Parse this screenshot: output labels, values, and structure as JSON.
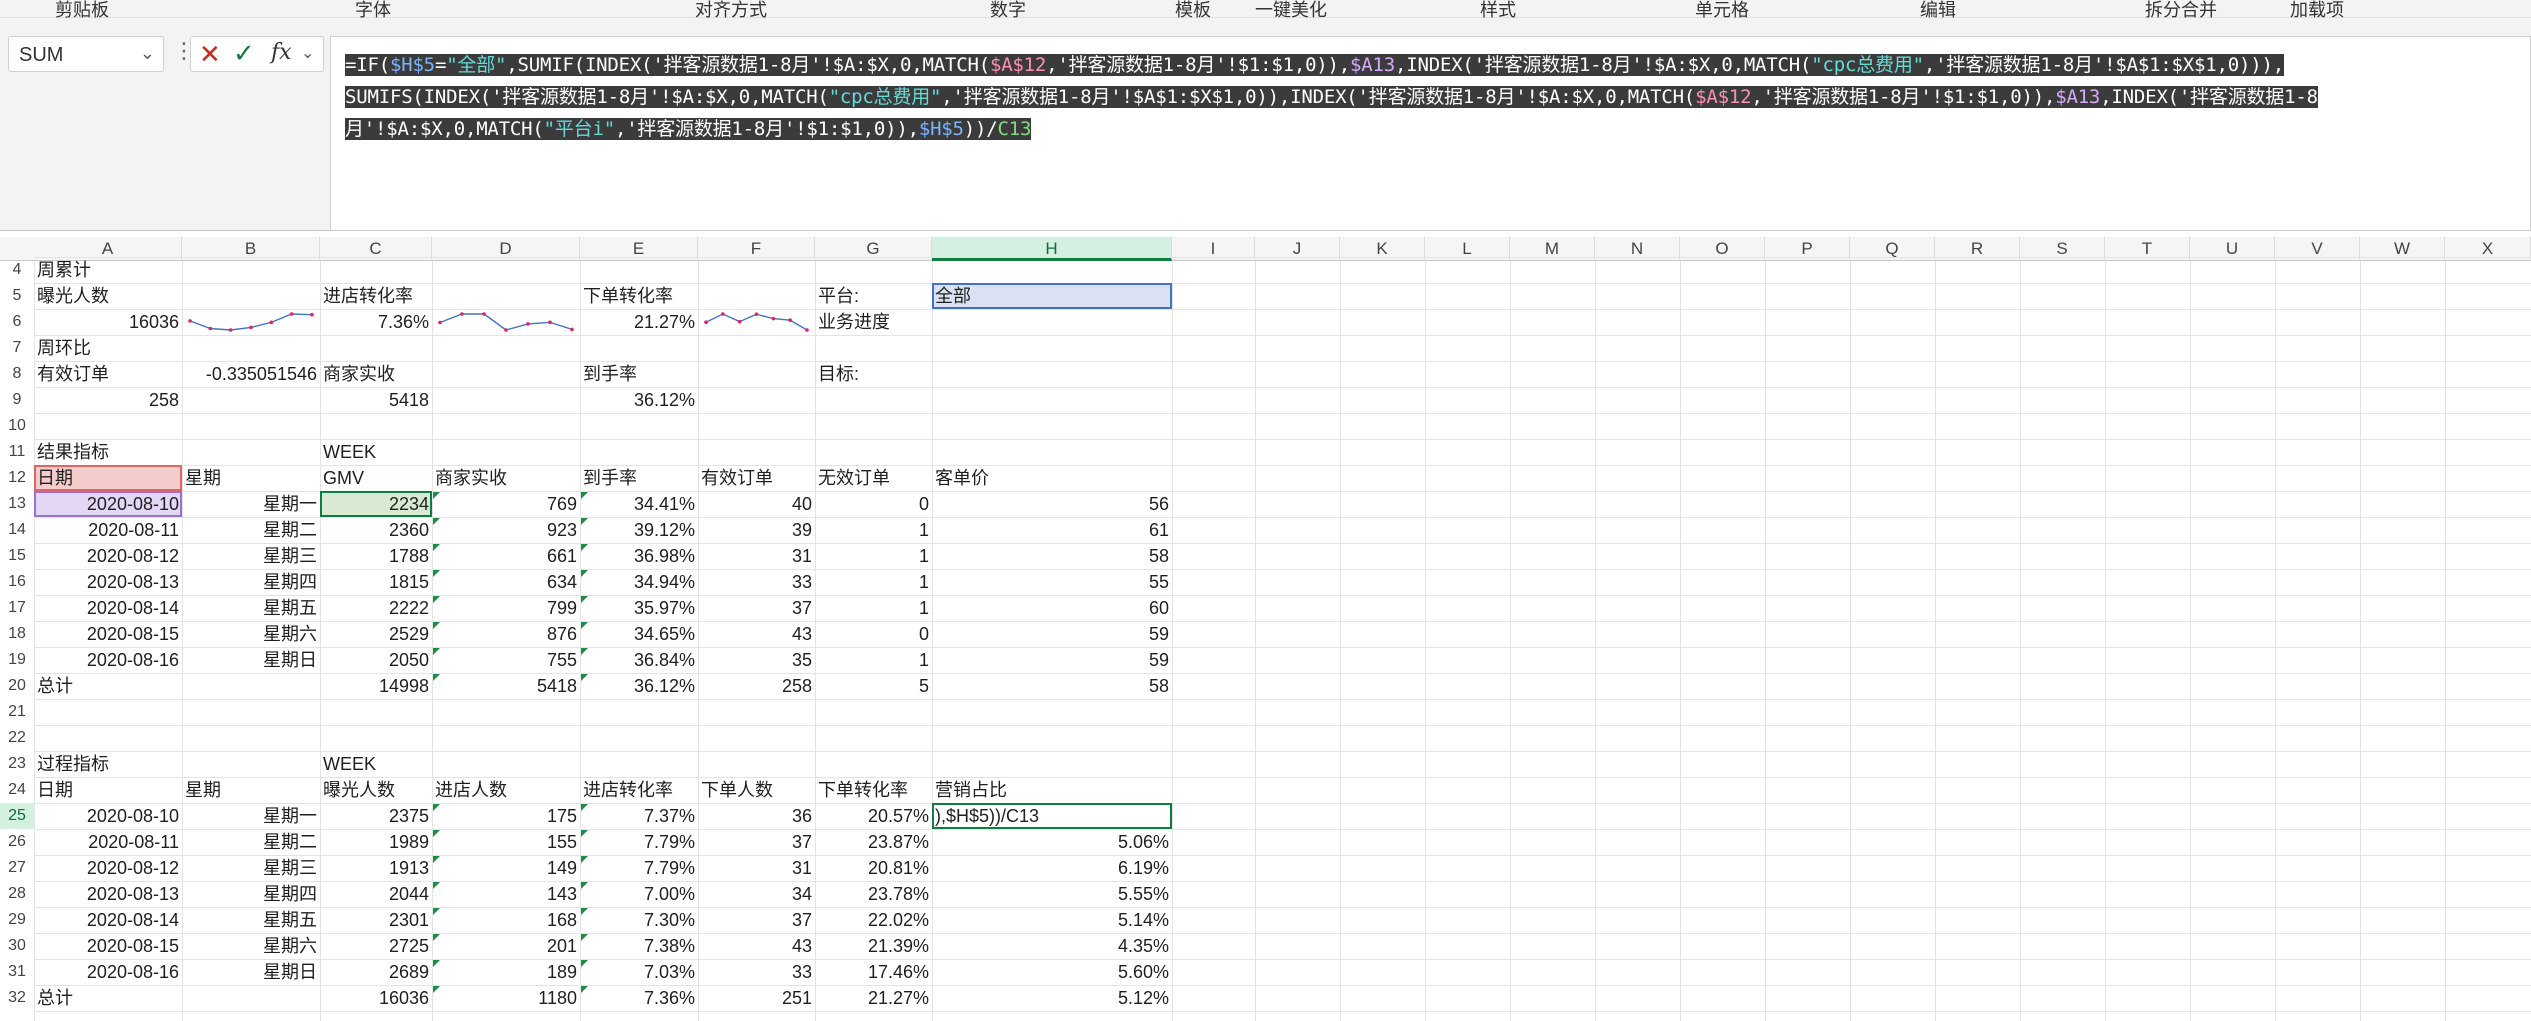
{
  "ribbon": {
    "groups": [
      "剪贴板",
      "字体",
      "对齐方式",
      "数字",
      "模板",
      "一键美化",
      "样式",
      "单元格",
      "编辑",
      "拆分合并",
      "加载项"
    ]
  },
  "formula_bar": {
    "name_box": "SUM",
    "fx_label": "fx",
    "formula_lines": [
      "=IF($H$5=\"全部\",SUMIF(INDEX('拌客源数据1-8月'!$A:$X,0,MATCH($A$12,'拌客源数据1-8月'!$1:$1,0)),$A13,INDEX('拌客源数据1-8月'!$A:$X,0,MATCH(\"cpc总费用\",'拌客源数据1-8月'!$A$1:$X$1,0))),",
      "SUMIFS(INDEX('拌客源数据1-8月'!$A:$X,0,MATCH(\"cpc总费用\",'拌客源数据1-8月'!$A$1:$X$1,0)),INDEX('拌客源数据1-8月'!$A:$X,0,MATCH($A$12,'拌客源数据1-8月'!$1:$1,0)),$A13,INDEX('拌客源数据1-8",
      "月'!$A:$X,0,MATCH(\"平台i\",'拌客源数据1-8月'!$1:$1,0)),$H$5))/C13"
    ]
  },
  "columns": [
    "A",
    "B",
    "C",
    "D",
    "E",
    "F",
    "G",
    "H",
    "I",
    "J",
    "K",
    "L",
    "M",
    "N",
    "O",
    "P",
    "Q",
    "R",
    "S",
    "T",
    "U",
    "V",
    "W",
    "X"
  ],
  "rows": [
    "4",
    "5",
    "6",
    "7",
    "8",
    "9",
    "10",
    "11",
    "12",
    "13",
    "14",
    "15",
    "16",
    "17",
    "18",
    "19",
    "20",
    "21",
    "22",
    "23",
    "24",
    "25",
    "26",
    "27",
    "28",
    "29",
    "30",
    "31",
    "32"
  ],
  "summary": {
    "a4": "周累计",
    "a5": "曝光人数",
    "c5": "进店转化率",
    "e5": "下单转化率",
    "g5": "平台:",
    "h5": "全部",
    "a6": "16036",
    "c6": "7.36%",
    "e6": "21.27%",
    "g6": "业务进度",
    "a7": "周环比",
    "a8": "有效订单",
    "b8": "-0.335051546",
    "c8": "商家实收",
    "e8": "到手率",
    "g8": "目标:",
    "a9": "258",
    "c9": "5418",
    "e9": "36.12%"
  },
  "results": {
    "section": "结果指标",
    "week_label": "WEEK",
    "headers": [
      "日期",
      "星期",
      "GMV",
      "商家实收",
      "到手率",
      "有效订单",
      "无效订单",
      "客单价"
    ],
    "rows": [
      [
        "2020-08-10",
        "星期一",
        "2234",
        "769",
        "34.41%",
        "40",
        "0",
        "56"
      ],
      [
        "2020-08-11",
        "星期二",
        "2360",
        "923",
        "39.12%",
        "39",
        "1",
        "61"
      ],
      [
        "2020-08-12",
        "星期三",
        "1788",
        "661",
        "36.98%",
        "31",
        "1",
        "58"
      ],
      [
        "2020-08-13",
        "星期四",
        "1815",
        "634",
        "34.94%",
        "33",
        "1",
        "55"
      ],
      [
        "2020-08-14",
        "星期五",
        "2222",
        "799",
        "35.97%",
        "37",
        "1",
        "60"
      ],
      [
        "2020-08-15",
        "星期六",
        "2529",
        "876",
        "34.65%",
        "43",
        "0",
        "59"
      ],
      [
        "2020-08-16",
        "星期日",
        "2050",
        "755",
        "36.84%",
        "35",
        "1",
        "59"
      ]
    ],
    "total": [
      "总计",
      "",
      "14998",
      "5418",
      "36.12%",
      "258",
      "5",
      "58"
    ]
  },
  "process": {
    "section": "过程指标",
    "week_label": "WEEK",
    "headers": [
      "日期",
      "星期",
      "曝光人数",
      "进店人数",
      "进店转化率",
      "下单人数",
      "下单转化率",
      "营销占比"
    ],
    "rows": [
      [
        "2020-08-10",
        "星期一",
        "2375",
        "175",
        "7.37%",
        "36",
        "20.57%",
        "),$H$5))/C13"
      ],
      [
        "2020-08-11",
        "星期二",
        "1989",
        "155",
        "7.79%",
        "37",
        "23.87%",
        "5.06%"
      ],
      [
        "2020-08-12",
        "星期三",
        "1913",
        "149",
        "7.79%",
        "31",
        "20.81%",
        "6.19%"
      ],
      [
        "2020-08-13",
        "星期四",
        "2044",
        "143",
        "7.00%",
        "34",
        "23.78%",
        "5.55%"
      ],
      [
        "2020-08-14",
        "星期五",
        "2301",
        "168",
        "7.30%",
        "37",
        "22.02%",
        "5.14%"
      ],
      [
        "2020-08-15",
        "星期六",
        "2725",
        "201",
        "7.38%",
        "43",
        "21.39%",
        "4.35%"
      ],
      [
        "2020-08-16",
        "星期日",
        "2689",
        "189",
        "7.03%",
        "33",
        "17.46%",
        "5.60%"
      ]
    ],
    "total": [
      "总计",
      "",
      "16036",
      "1180",
      "7.36%",
      "251",
      "21.27%",
      "5.12%"
    ]
  },
  "sparklines": {
    "exposure": [
      2375,
      1989,
      1913,
      2044,
      2301,
      2725,
      2689
    ],
    "store_conv": [
      7.37,
      7.79,
      7.79,
      7.0,
      7.3,
      7.38,
      7.03
    ],
    "order_conv": [
      20.57,
      23.87,
      20.81,
      23.78,
      22.02,
      21.39,
      17.46
    ]
  },
  "colors": {
    "excel_green": "#107c41",
    "sparkline": "#4472c4",
    "sparkline_marker": "#e0245e"
  }
}
